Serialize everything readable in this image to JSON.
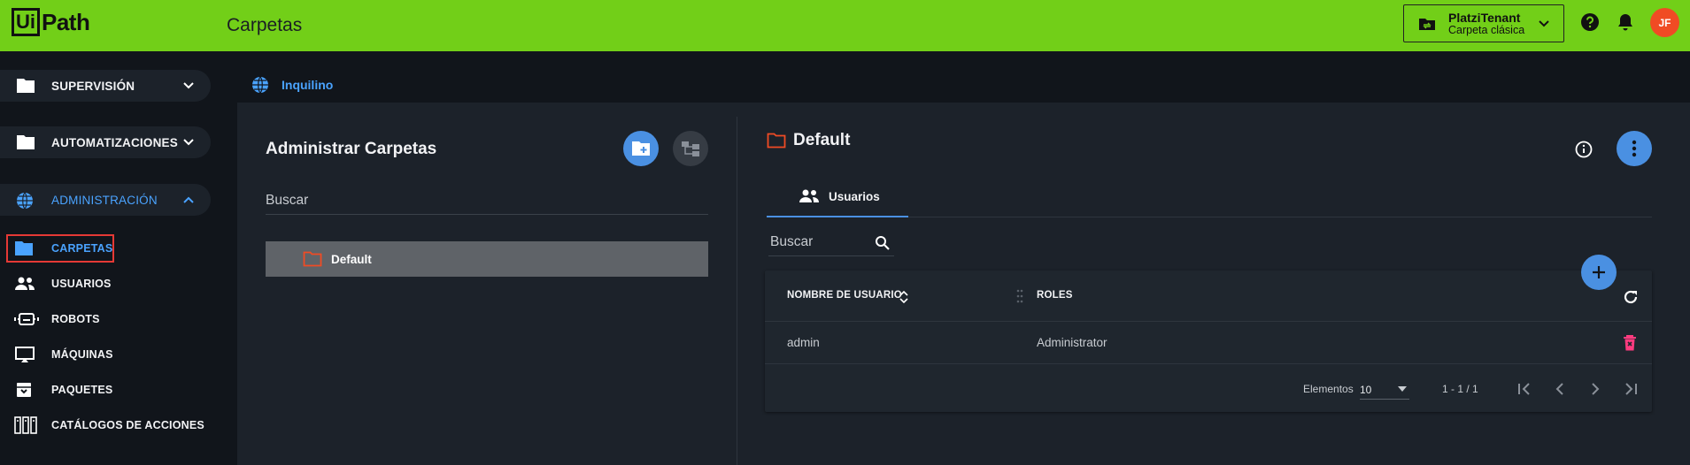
{
  "header": {
    "logo_box": "Ui",
    "logo_text": "Path",
    "page_title": "Carpetas",
    "tenant_name": "PlatziTenant",
    "tenant_sub": "Carpeta clásica",
    "avatar_initials": "JF",
    "brand_color": "#72cf18"
  },
  "sidebar": {
    "groups": [
      {
        "label": "SUPERVISIÓN",
        "icon": "folder-icon"
      },
      {
        "label": "AUTOMATIZACIONES",
        "icon": "folder-icon"
      },
      {
        "label": "ADMINISTRACIÓN",
        "icon": "globe-icon"
      }
    ],
    "items": [
      {
        "label": "CARPETAS",
        "icon": "folder-icon",
        "active": true
      },
      {
        "label": "USUARIOS",
        "icon": "users-icon"
      },
      {
        "label": "ROBOTS",
        "icon": "robot-icon"
      },
      {
        "label": "MÁQUINAS",
        "icon": "monitor-icon"
      },
      {
        "label": "PAQUETES",
        "icon": "package-icon"
      },
      {
        "label": "CATÁLOGOS DE ACCIONES",
        "icon": "catalog-icon"
      }
    ]
  },
  "breadcrumb": {
    "label": "Inquilino"
  },
  "left_panel": {
    "title": "Administrar Carpetas",
    "search_placeholder": "Buscar",
    "tree": [
      {
        "label": "Default",
        "selected": true
      }
    ]
  },
  "right_panel": {
    "title": "Default",
    "tabs": [
      {
        "label": "Usuarios",
        "active": true
      }
    ],
    "search_placeholder": "Buscar",
    "table": {
      "columns": [
        "NOMBRE DE USUARIO",
        "ROLES"
      ],
      "rows": [
        {
          "user": "admin",
          "roles": "Administrator"
        }
      ]
    },
    "pager": {
      "label": "Elementos",
      "page_size": "10",
      "range": "1 - 1 / 1"
    }
  }
}
